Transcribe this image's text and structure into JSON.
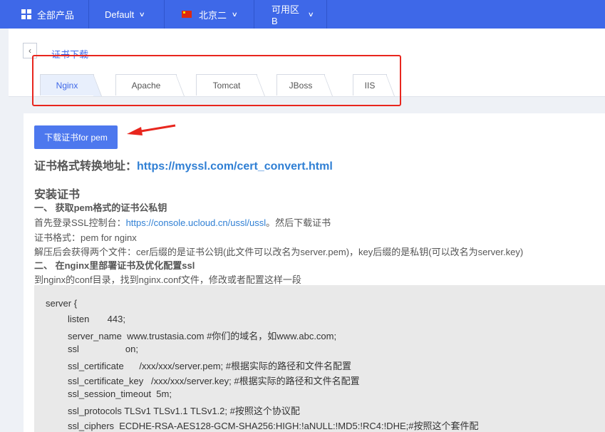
{
  "topbar": {
    "products": "全部产品",
    "project": "Default",
    "region": "北京二",
    "zone": "可用区B"
  },
  "header": {
    "title": "证书下载",
    "tabs": [
      "Nginx",
      "Apache",
      "Tomcat",
      "JBoss",
      "IIS"
    ],
    "active_tab": "Nginx"
  },
  "main": {
    "download_button": "下载证书for pem",
    "convert_label": "证书格式转换地址：",
    "convert_url": "https://myssl.com/cert_convert.html",
    "install_title": "安装证书",
    "step1": "一、 获取pem格式的证书公私钥",
    "step1_line1_prefix": "首先登录SSL控制台：",
    "step1_line1_link": "https://console.ucloud.cn/ussl/ussl",
    "step1_line1_suffix": "。然后下载证书",
    "step1_line2": "证书格式：pem for nginx",
    "step1_line3": "解压后会获得两个文件：cer后缀的是证书公钥(此文件可以改名为server.pem)，key后缀的是私钥(可以改名为server.key)",
    "step2": "二、 在nginx里部署证书及优化配置ssl",
    "step2_line1": "到nginx的conf目录，找到nginx.conf文件，修改或者配置这样一段"
  },
  "code": {
    "lines": [
      "server {",
      "listen       443;",
      "server_name  www.trustasia.com #你们的域名，如www.abc.com;",
      "ssl                  on;",
      "ssl_certificate      /xxx/xxx/server.pem; #根据实际的路径和文件名配置",
      "ssl_certificate_key   /xxx/xxx/server.key; #根据实际的路径和文件名配置",
      "ssl_session_timeout  5m;",
      "ssl_protocols TLSv1 TLSv1.1 TLSv1.2; #按照这个协议配",
      "ssl_ciphers  ECDHE-RSA-AES128-GCM-SHA256:HIGH:!aNULL:!MD5:!RC4:!DHE;#按照这个套件配"
    ]
  },
  "colors": {
    "topbar": "#3e68e8",
    "accent": "#3e68e8",
    "link": "#2f7fd4",
    "annotation_red": "#e8261e"
  }
}
